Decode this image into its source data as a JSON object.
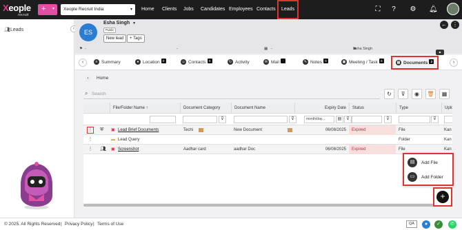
{
  "topbar": {
    "logo_brand_x": "X",
    "logo_brand_rest": "eople",
    "logo_sub": "recruit",
    "plus_label": "+",
    "org": "Xeople Recruit India",
    "nav": [
      "Home",
      "Clients",
      "Jobs",
      "Candidates",
      "Employees",
      "Contacts",
      "Leads"
    ],
    "icons": [
      "fullscreen-icon",
      "help-icon",
      "settings-icon",
      "bell-icon"
    ]
  },
  "sidebar": {
    "item": "Leads",
    "collapse": "‹"
  },
  "header": {
    "initials": "ES",
    "name": "Esha Singh",
    "badge": "Public",
    "new_lead": "New lead",
    "tags": "+ Tags"
  },
  "fields": {
    "f1": "-",
    "f2": "-",
    "f3": "-",
    "owner": "Esha Singh"
  },
  "tabs": [
    {
      "label": "Summary",
      "badge": ""
    },
    {
      "label": "Location",
      "badge": "0"
    },
    {
      "label": "Contacts",
      "badge": "0"
    },
    {
      "label": "Activity",
      "badge": ""
    },
    {
      "label": "Mail",
      "badge": ""
    },
    {
      "label": "Notes",
      "badge": "0"
    },
    {
      "label": "Meeting / Task",
      "badge": "0"
    },
    {
      "label": "Documents",
      "badge": "2"
    }
  ],
  "breadcrumb": "Home",
  "search": {
    "placeholder": "Search"
  },
  "grid": {
    "columns": [
      "File/Folder Name ↑",
      "Document Category",
      "Document Name",
      "Expiry Date",
      "Status",
      "Type",
      "Uplo"
    ],
    "date_filter": "month/day...",
    "rows": [
      {
        "name": "Lead Brief Documents",
        "category": "Techi",
        "docname": "New Document",
        "expiry": "06/08/2025",
        "status": "Expired",
        "type": "File",
        "upl": "Kan"
      },
      {
        "name": "Lead Query",
        "category": "",
        "docname": "",
        "expiry": "",
        "status": "",
        "type": "Folder",
        "upl": "Kan"
      },
      {
        "name": "Screenshot",
        "category": "Aadhar card",
        "docname": "aadhar Doc",
        "expiry": "06/08/2025",
        "status": "Expired",
        "type": "File",
        "upl": "Kan"
      }
    ]
  },
  "popup": {
    "add_file": "Add File",
    "add_folder": "Add Folder"
  },
  "fab": "+",
  "footer": {
    "copyright": "© 2025. All Rights Reserved",
    "sep": "|",
    "privacy": "Privacy Policy",
    "terms": "Terms of Use",
    "qa": "QA"
  },
  "colors": {
    "brand": "#e44fa4",
    "accent": "#d33333",
    "avatar": "#2a7dd3",
    "expired": "#d22244"
  }
}
